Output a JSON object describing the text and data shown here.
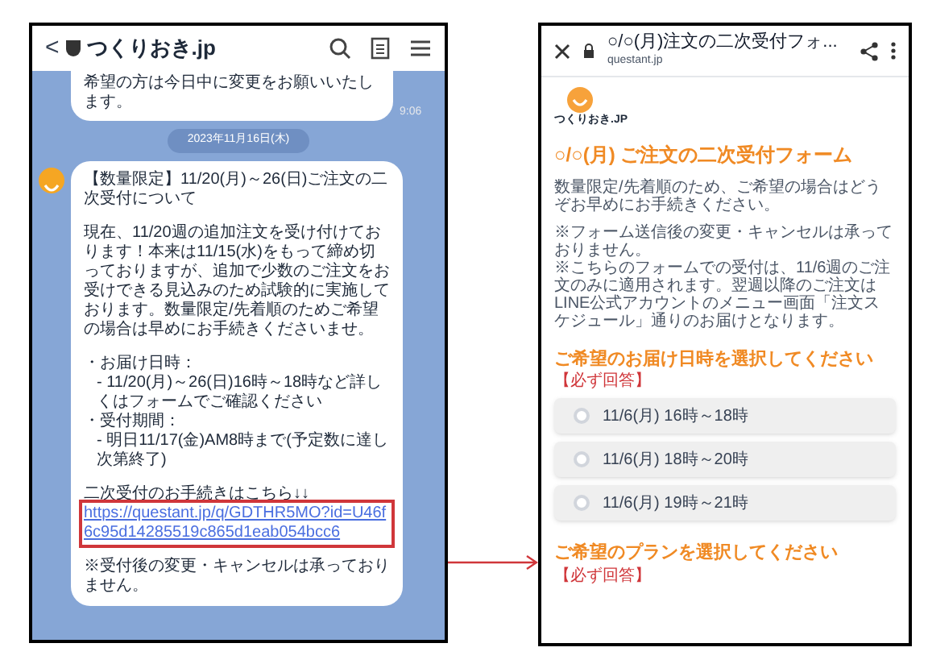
{
  "chat": {
    "header": {
      "back": "<",
      "title": "つくりおき.jp"
    },
    "previous_message": {
      "text": "希望の方は今日中に変更をお願いいたします。",
      "time": "9:06"
    },
    "date": "2023年11月16日(木)",
    "message": {
      "paragraphs": [
        "【数量限定】11/20(月)～26(日)ご注文の二次受付について",
        "現在、11/20週の追加注文を受け付けております！本来は11/15(水)をもって締め切っておりますが、追加で少数のご注文をお受けできる見込みのため試験的に実施しております。数量限定/先着順のためご希望の場合は早めにお手続きくださいませ。"
      ],
      "details": [
        {
          "label": "・お届け日時：",
          "value": "- 11/20(月)～26(日)16時～18時など詳しくはフォームでご確認ください"
        },
        {
          "label": "・受付期間：",
          "value": "- 明日11/17(金)AM8時まで(予定数に達し次第終了)"
        }
      ],
      "link_intro": "二次受付のお手続きはこちら↓↓",
      "link": "https://questant.jp/q/GDTHR5MO?id=U46f6c95d14285519c865d1eab054bcc6",
      "note": "※受付後の変更・キャンセルは承っておりません。"
    }
  },
  "form": {
    "header": {
      "title": "○/○(月)注文の二次受付フォ...",
      "domain": "questant.jp"
    },
    "logo_text": "つくりおき.JP",
    "title": "○/○(月) ご注文の二次受付フォーム",
    "intro": "数量限定/先着順のため、ご希望の場合はどうぞお早めにお手続きください。",
    "notes": [
      "※フォーム送信後の変更・キャンセルは承っておりません。",
      "※こちらのフォームでの受付は、11/6週のご注文のみに適用されます。翌週以降のご注文はLINE公式アカウントのメニュー画面「注文スケジュール」通りのお届けとなります。"
    ],
    "questions": [
      {
        "title": "ご希望のお届け日時を選択してください",
        "required": "【必ず回答】",
        "options": [
          {
            "label": "11/6(月) 16時～18時",
            "selected": false
          },
          {
            "label": "11/6(月) 18時～20時",
            "selected": false
          },
          {
            "label": "11/6(月) 19時～21時",
            "selected": false
          }
        ]
      },
      {
        "title": "ご希望のプランを選択してください",
        "required": "【必ず回答】"
      }
    ]
  }
}
